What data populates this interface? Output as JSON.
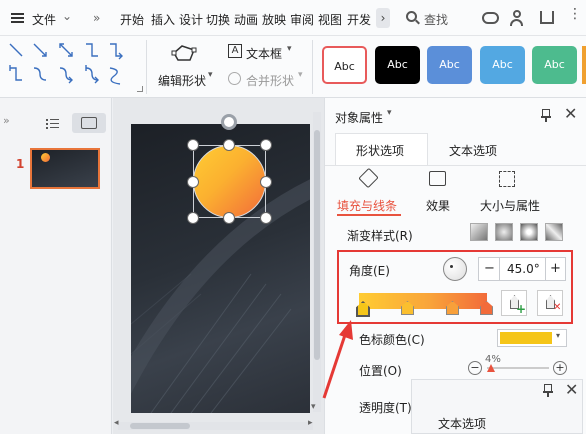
{
  "menubar": {
    "file_label": "文件",
    "tabs": [
      "开始",
      "插入",
      "设计",
      "切换",
      "动画",
      "放映",
      "审阅",
      "视图",
      "开发"
    ],
    "search_placeholder": "查找"
  },
  "ribbon": {
    "edit_shape_label": "编辑形状",
    "textbox_label": "文本框",
    "merge_shape_label": "合并形状",
    "style_swatches": [
      {
        "label": "Abc",
        "bg": "#ffffff",
        "fg": "#222222",
        "border": "#e85a5a"
      },
      {
        "label": "Abc",
        "bg": "#000000",
        "fg": "#ffffff",
        "border": "#000000"
      },
      {
        "label": "Abc",
        "bg": "#5b8fd9",
        "fg": "#ffffff",
        "border": "#4a7fc9"
      },
      {
        "label": "Abc",
        "bg": "#53a8e2",
        "fg": "#ffffff",
        "border": "#4398d2"
      },
      {
        "label": "Abc",
        "bg": "#4dbb8e",
        "fg": "#ffffff",
        "border": "#3dab7e"
      }
    ]
  },
  "thumbnails": {
    "slide_number": "1"
  },
  "panel": {
    "title": "对象属性",
    "tab_shape": "形状选项",
    "tab_text": "文本选项",
    "subtab_fill": "填充与线条",
    "subtab_effect": "效果",
    "subtab_size": "大小与属性",
    "gradient_style_label": "渐变样式(R)",
    "angle_label": "角度(E)",
    "angle_value": "45.0°",
    "stop_color_label": "色标颜色(C)",
    "position_label": "位置(O)",
    "position_value": "4%",
    "transparency_label": "透明度(T)",
    "floating_tab_label": "文本选项"
  },
  "colors": {
    "accent": "#e8533f",
    "highlight_box": "#e53935",
    "gradient_start": "#ffcc33",
    "gradient_end": "#f26b3a",
    "stop_color": "#f5c518"
  }
}
